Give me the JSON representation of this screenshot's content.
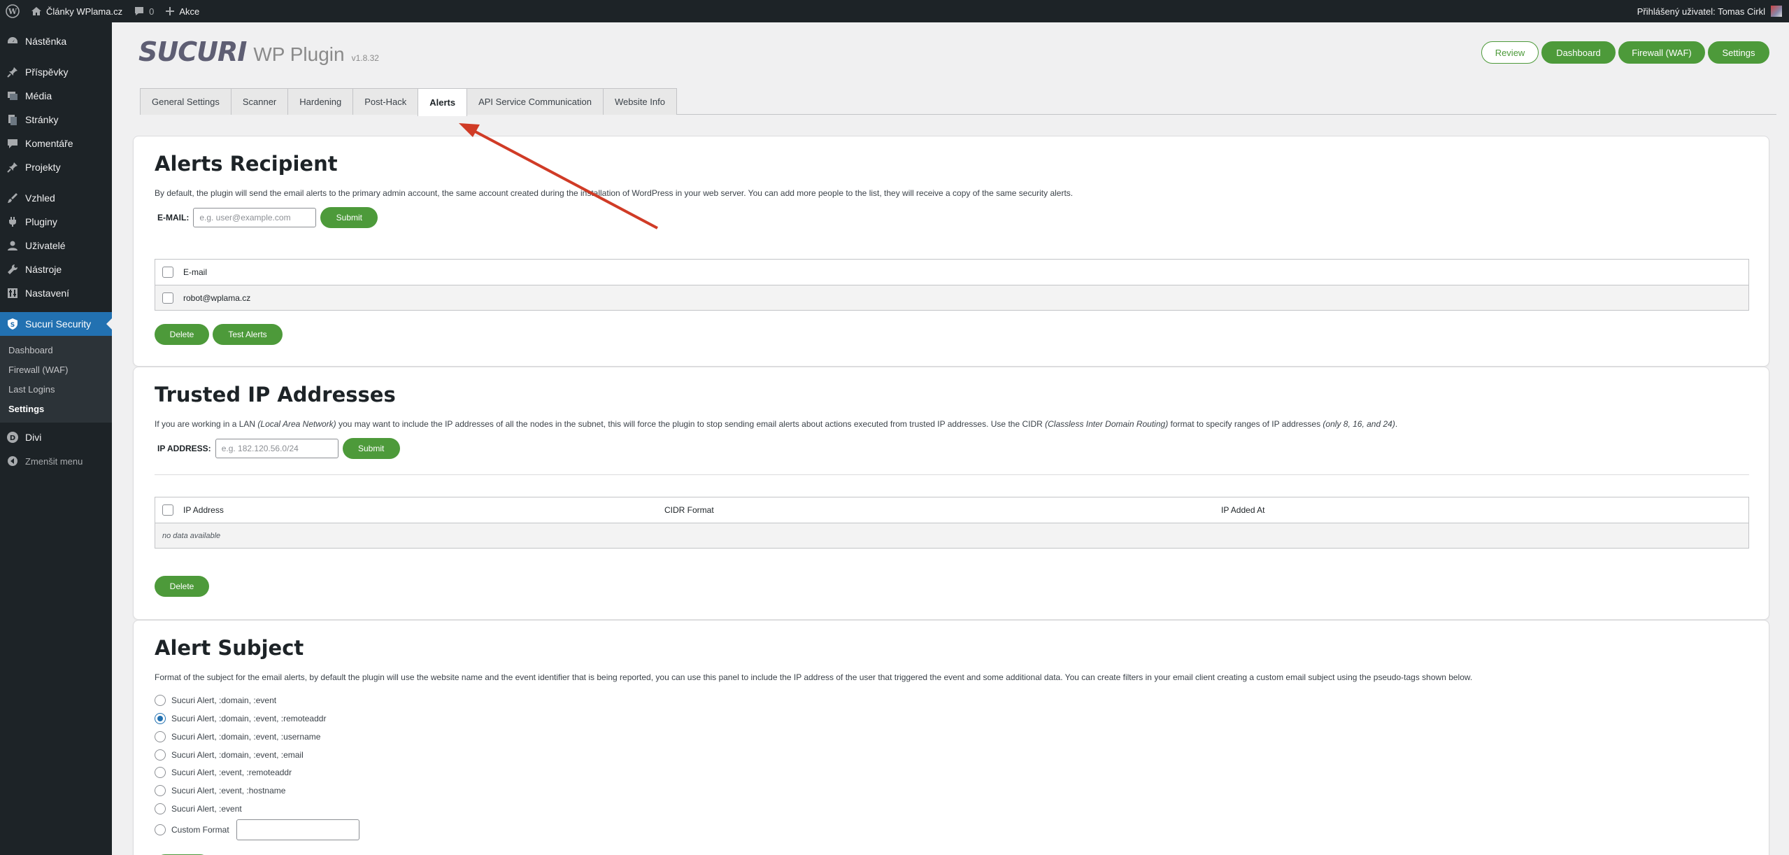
{
  "adminbar": {
    "site_name": "Články WPlama.cz",
    "comments_count": "0",
    "new_label": "Akce",
    "greeting": "Přihlášený uživatel: Tomas Cirkl"
  },
  "sidebar": {
    "items": [
      {
        "label": "Nástěnka",
        "icon": "dashboard-icon"
      },
      {
        "label": "Příspěvky",
        "icon": "pin-icon"
      },
      {
        "label": "Média",
        "icon": "media-icon"
      },
      {
        "label": "Stránky",
        "icon": "page-icon"
      },
      {
        "label": "Komentáře",
        "icon": "comment-icon"
      },
      {
        "label": "Projekty",
        "icon": "pin-icon"
      },
      {
        "label": "Vzhled",
        "icon": "brush-icon"
      },
      {
        "label": "Pluginy",
        "icon": "plugin-icon"
      },
      {
        "label": "Uživatelé",
        "icon": "user-icon"
      },
      {
        "label": "Nástroje",
        "icon": "wrench-icon"
      },
      {
        "label": "Nastavení",
        "icon": "settings-icon"
      }
    ],
    "current": {
      "label": "Sucuri Security",
      "icon": "shield-icon"
    },
    "submenu": [
      "Dashboard",
      "Firewall (WAF)",
      "Last Logins",
      "Settings"
    ],
    "after": [
      {
        "label": "Divi",
        "icon": "divi-icon"
      }
    ],
    "collapse_label": "Zmenšit menu"
  },
  "header": {
    "brand": "SUCURI",
    "product": "WP Plugin",
    "version": "v1.8.32",
    "buttons": {
      "review": "Review",
      "dashboard": "Dashboard",
      "firewall": "Firewall (WAF)",
      "settings": "Settings"
    }
  },
  "tabs": [
    "General Settings",
    "Scanner",
    "Hardening",
    "Post-Hack",
    "Alerts",
    "API Service Communication",
    "Website Info"
  ],
  "active_tab": "Alerts",
  "recipient": {
    "title": "Alerts Recipient",
    "description": "By default, the plugin will send the email alerts to the primary admin account, the same account created during the installation of WordPress in your web server. You can add more people to the list, they will receive a copy of the same security alerts.",
    "email_label": "E-MAIL:",
    "email_placeholder": "e.g. user@example.com",
    "submit": "Submit",
    "table_header": "E-mail",
    "emails": [
      "robot@wplama.cz"
    ],
    "delete": "Delete",
    "test": "Test Alerts"
  },
  "trusted": {
    "title": "Trusted IP Addresses",
    "desc_part1": "If you are working in a LAN ",
    "desc_italic1": "(Local Area Network)",
    "desc_part2": " you may want to include the IP addresses of all the nodes in the subnet, this will force the plugin to stop sending email alerts about actions executed from trusted IP addresses. Use the CIDR ",
    "desc_italic2": "(Classless Inter Domain Routing)",
    "desc_part3": " format to specify ranges of IP addresses ",
    "desc_italic3": "(only 8, 16, and 24)",
    "desc_part4": ".",
    "ip_label": "IP ADDRESS:",
    "ip_placeholder": "e.g. 182.120.56.0/24",
    "submit": "Submit",
    "columns": [
      "IP Address",
      "CIDR Format",
      "IP Added At"
    ],
    "empty": "no data available",
    "delete": "Delete"
  },
  "subject": {
    "title": "Alert Subject",
    "description": "Format of the subject for the email alerts, by default the plugin will use the website name and the event identifier that is being reported, you can use this panel to include the IP address of the user that triggered the event and some additional data. You can create filters in your email client creating a custom email subject using the pseudo-tags shown below.",
    "options": [
      {
        "label": "Sucuri Alert, :domain, :event",
        "checked": false
      },
      {
        "label": "Sucuri Alert, :domain, :event, :remoteaddr",
        "checked": true
      },
      {
        "label": "Sucuri Alert, :domain, :event, :username",
        "checked": false
      },
      {
        "label": "Sucuri Alert, :domain, :event, :email",
        "checked": false
      },
      {
        "label": "Sucuri Alert, :event, :remoteaddr",
        "checked": false
      },
      {
        "label": "Sucuri Alert, :event, :hostname",
        "checked": false
      },
      {
        "label": "Sucuri Alert, :event",
        "checked": false
      }
    ],
    "custom_label": "Custom Format",
    "custom_value": ""
  },
  "colors": {
    "accent_green": "#4d9a3a",
    "wp_blue": "#2271b1",
    "annotation_red": "#d03b26"
  }
}
